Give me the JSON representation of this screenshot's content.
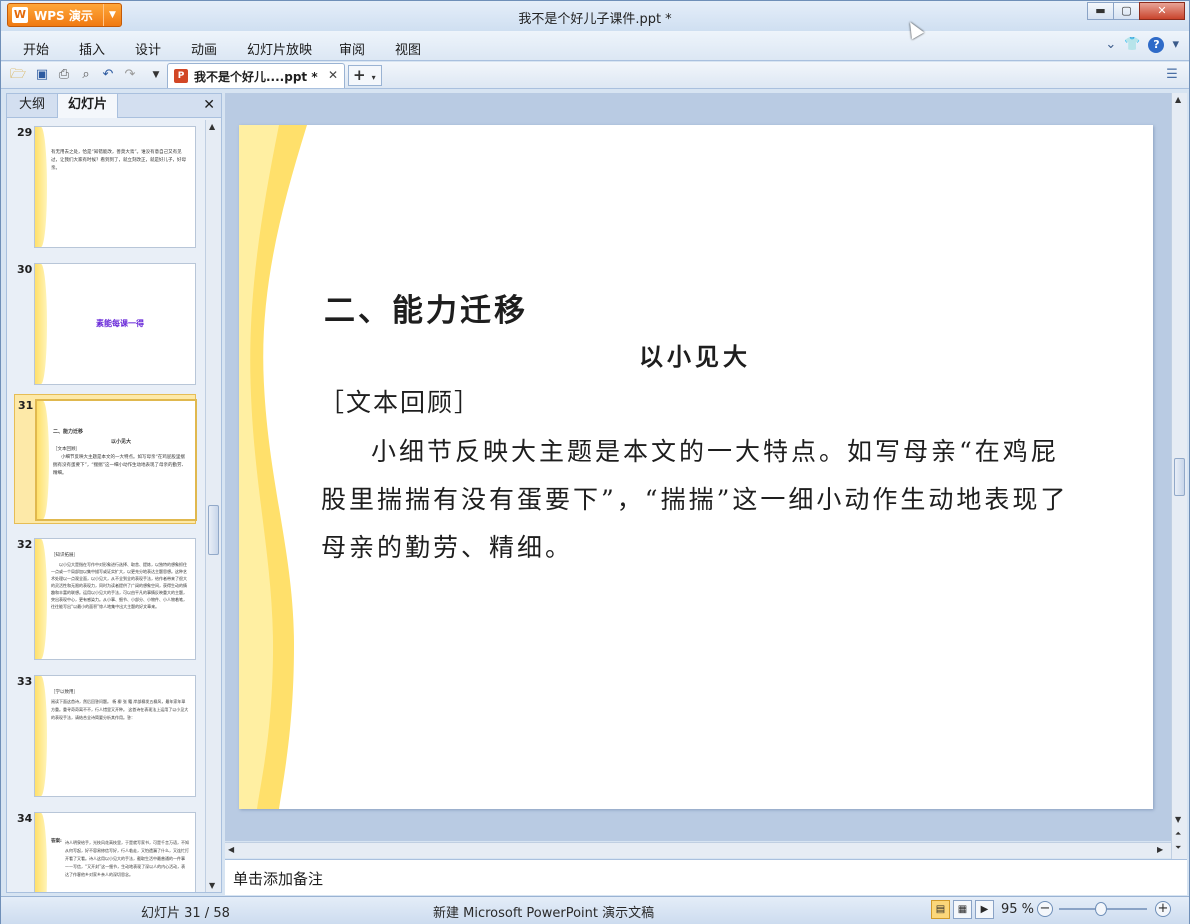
{
  "app": {
    "name": "WPS 演示",
    "title": "我不是个好儿子课件.ppt *"
  },
  "window_controls": {
    "minimize": "▭",
    "maximize": "□",
    "close": "✕"
  },
  "menu": {
    "items": [
      "开始",
      "插入",
      "设计",
      "动画",
      "幻灯片放映",
      "审阅",
      "视图"
    ]
  },
  "toolbar": {
    "tab_label": "我不是个好儿....ppt *",
    "tab_close": "✕",
    "new_tab": "+"
  },
  "panel": {
    "tabs": [
      "大纲",
      "幻灯片"
    ],
    "close": "✕"
  },
  "thumbnails": [
    {
      "num": "29",
      "text": "有无用去之处，恰是“知错能改，善莫大焉”。谁没有意自己又有见过，让我们大家有时候？看到到了，就立刻改正，就是好儿子，好母亲。"
    },
    {
      "num": "30",
      "text": "素能每课一得"
    },
    {
      "num": "31",
      "title": "二、能力迁移",
      "sub": "以小见大",
      "section": "［文本回顾］",
      "text": "小细节反映大主题是本文的一大特点。如写母亲“在鸡屁股里揣揣有没有蛋要下”，“揣揣”这一细小动作生动地表现了母亲的勤劳、精细。"
    },
    {
      "num": "32",
      "section": "［知识拓展］",
      "text": "以小见大是指在写作中对形象进行选择、取舍、提炼，以独特的想象抓住一点或一个局部加以集中描写或证实扩大，以更充分地表达主题思想。这种艺术处理以一点观全面，以小见大，从不全到全的表现手法，给作者带来了很大的灵活性和无限的表现力，同时为读者提供了广阔的想象空间，获得生动的情趣和丰富的联想。运用以小见大的手法，可以由平凡的事情反映重大的主题，突出表现中心，更有感染力。从小事、细节、小部分、小物件、小人物着笔，往往能写出“以最小的面积”惊人地集中出大主题的好文章来。"
    },
    {
      "num": "33",
      "section": "［学以致用］",
      "text": "阅读下面这首诗，然后回答问题。 杨 柳 张 籍 岸部柳发五柳风，最年家年翠方重。重寻奇奇离不不，行人惜里又开种。 这首诗在表现法上运用了以小见大的表现手法，请结合全诗简要分析其作用。答："
    },
    {
      "num": "34",
      "section": "答案:",
      "text": "诗人明泉给手，光枝风花高枝里，于是就写家书，可是千言万语，不知从何写起，好不容易修信写好，行人临走，又怕遗漏了什么，又连忙打开看了又看。诗人这用以小见大的手法，截取生活中最普通的一件事——写信，“又开封”这一细节，生动地表现了深以人的内心活动，表达了作客他乡对家乡亲人的深切思念。"
    }
  ],
  "slide": {
    "title": "二、能力迁移",
    "subtitle": "以小见大",
    "section": "［文本回顾］",
    "body": "小细节反映大主题是本文的一大特点。如写母亲“在鸡屁股里揣揣有没有蛋要下”，“揣揣”这一细小动作生动地表现了母亲的勤劳、精细。"
  },
  "notes": {
    "placeholder": "单击添加备注"
  },
  "status": {
    "slide_pos": "幻灯片 31 / 58",
    "template": "新建 Microsoft PowerPoint 演示文稿",
    "zoom": "95 %",
    "zoom_level": 0.45
  },
  "colors": {
    "accent": "#f07a12",
    "wave": "#ffe06b"
  }
}
